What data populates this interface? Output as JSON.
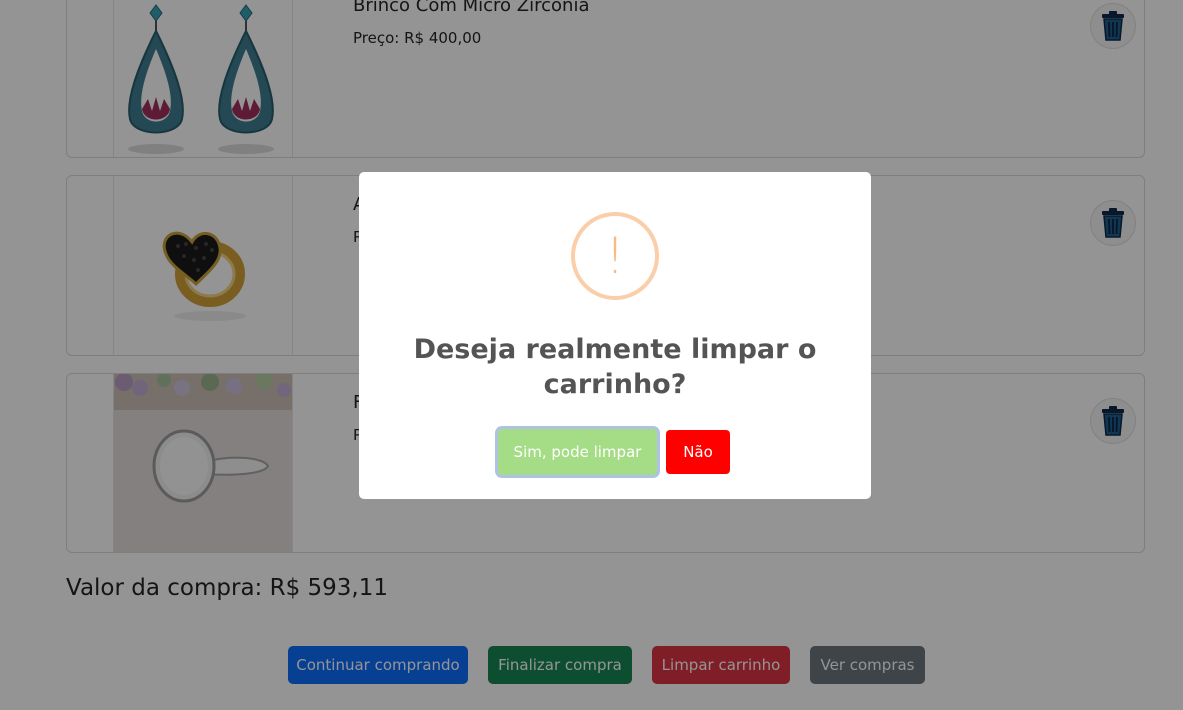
{
  "cart": {
    "items": [
      {
        "title": "Brinco Com Micro Zirconia",
        "price": "Preço: R$ 400,00",
        "image": "earrings-image"
      },
      {
        "title": "A",
        "price": "P",
        "image": "heart-ring-image"
      },
      {
        "title": "F",
        "price": "P",
        "image": "signet-ring-image"
      }
    ],
    "remove_icon": "trash-icon",
    "total_label": "Valor da compra: R$ 593,11"
  },
  "actions": {
    "continue": "Continuar comprando",
    "finish": "Finalizar compra",
    "clear": "Limpar carrinho",
    "history": "Ver compras"
  },
  "colors": {
    "primary": "#0d6efd",
    "success": "#198754",
    "danger": "#dc3545",
    "secondary": "#6c757d",
    "modal_confirm": "#a5dc86",
    "modal_cancel": "#ff0000",
    "warning_icon": "#f8bb86"
  },
  "modal": {
    "icon": "!",
    "icon_name": "warning-icon",
    "title": "Deseja realmente limpar o carrinho?",
    "confirm_label": "Sim, pode limpar",
    "cancel_label": "Não"
  }
}
